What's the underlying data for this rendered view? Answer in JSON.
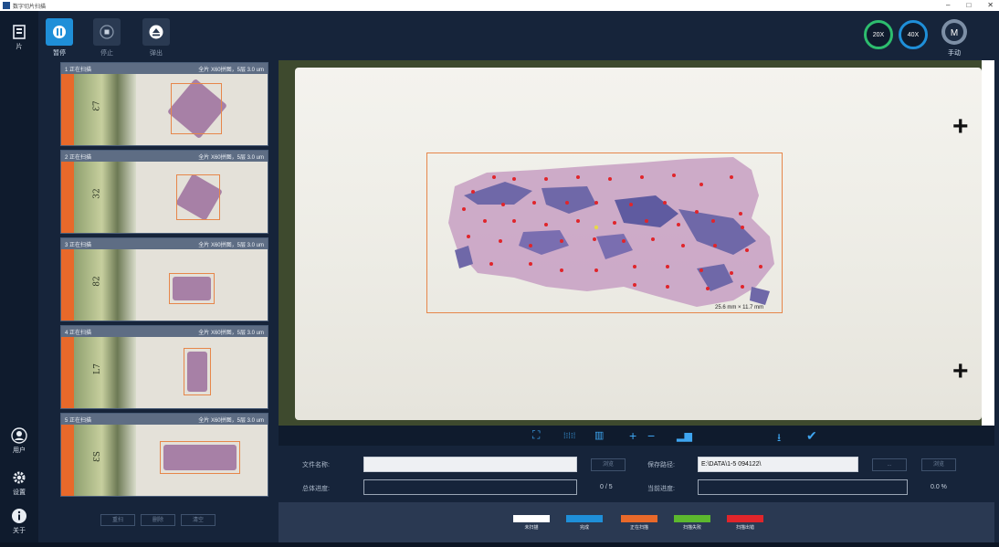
{
  "window": {
    "title": "数字切片扫描",
    "controls": [
      "–",
      "□",
      "✕"
    ]
  },
  "sidebar": {
    "top_item": {
      "label": "片",
      "icon": "slides-icon"
    },
    "bottom_items": [
      {
        "label": "用户",
        "icon": "user-icon"
      },
      {
        "label": "设置",
        "icon": "gear-icon"
      },
      {
        "label": "关于",
        "icon": "info-icon"
      }
    ]
  },
  "toolbar": {
    "pause_label": "暂停",
    "stop_label": "停止",
    "eject_label": "弹出",
    "manual_label": "手动",
    "mag_20x": "20X",
    "mag_40x": "40X",
    "mode_letter": "M"
  },
  "slide_list": [
    {
      "index_title": "1  正在扫描",
      "info": "全片 X60拼图，5层 3.0 um"
    },
    {
      "index_title": "2  正在扫描",
      "info": "全片 X60拼图，5层 3.0 um"
    },
    {
      "index_title": "3  正在扫描",
      "info": "全片 X60拼图，5层 3.0 um"
    },
    {
      "index_title": "4  正在扫描",
      "info": "全片 X60拼图，5层 3.0 um"
    },
    {
      "index_title": "5  正在扫描",
      "info": "全片 X60拼图，5层 3.0 um"
    }
  ],
  "list_buttons": [
    "重扫",
    "删除",
    "清空"
  ],
  "viewer": {
    "scale_text": "25.6 mm × 11.7 mm"
  },
  "form": {
    "file_name_label": "文件名称:",
    "file_name_value": "",
    "file_btn": "浏览",
    "save_path_label": "保存路径:",
    "save_path_value": "E:\\DATA\\1-5 094122\\",
    "path_btn_1": "...",
    "path_btn_2": "浏览",
    "total_progress_label": "总体进度:",
    "total_progress_value": "0 / 5",
    "total_progress_fraction": 0,
    "current_progress_label": "当前进度:",
    "current_progress_value": "0.0 %",
    "current_progress_fraction": 0
  },
  "legend": [
    {
      "label": "未扫描",
      "color": "#ffffff"
    },
    {
      "label": "完成",
      "color": "#1f8fd8"
    },
    {
      "label": "正在扫描",
      "color": "#e8692a"
    },
    {
      "label": "扫描失败",
      "color": "#5cb82e"
    },
    {
      "label": "扫描出错",
      "color": "#e0252b"
    }
  ]
}
